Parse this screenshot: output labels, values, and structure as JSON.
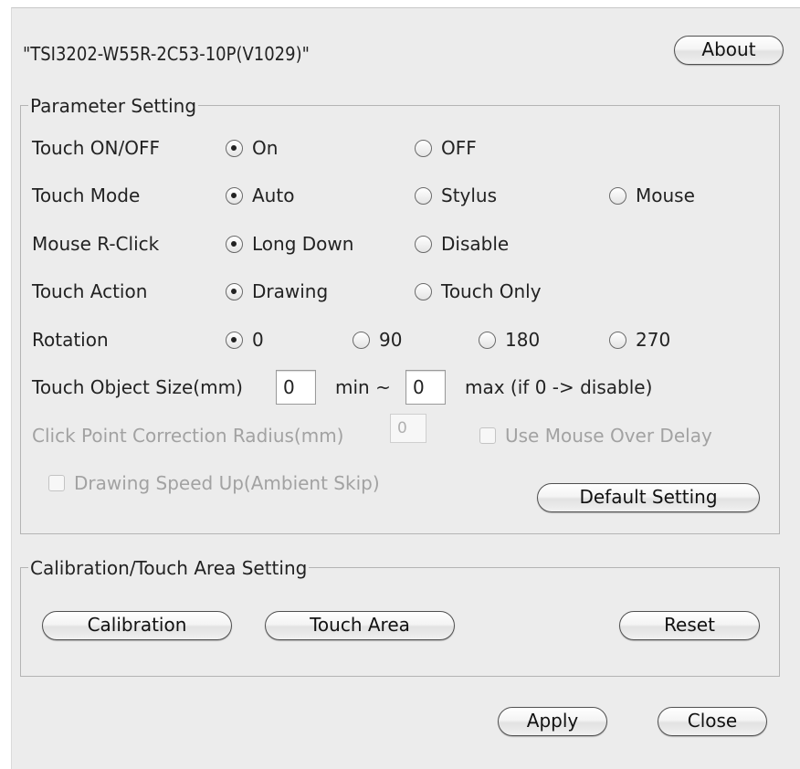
{
  "header": {
    "device_title": "\"TSI3202-W55R-2C53-10P(V1029)\"",
    "about_label": "About"
  },
  "parameter_setting": {
    "title": "Parameter Setting",
    "rows": {
      "touch_onoff": {
        "label": "Touch ON/OFF",
        "options": [
          "On",
          "OFF"
        ],
        "selected": "On"
      },
      "touch_mode": {
        "label": "Touch Mode",
        "options": [
          "Auto",
          "Stylus",
          "Mouse"
        ],
        "selected": "Auto"
      },
      "mouse_rclick": {
        "label": "Mouse R-Click",
        "options": [
          "Long Down",
          "Disable"
        ],
        "selected": "Long Down"
      },
      "touch_action": {
        "label": "Touch Action",
        "options": [
          "Drawing",
          "Touch Only"
        ],
        "selected": "Drawing"
      },
      "rotation": {
        "label": "Rotation",
        "options": [
          "0",
          "90",
          "180",
          "270"
        ],
        "selected": "0"
      }
    },
    "object_size": {
      "label": "Touch Object Size(mm)",
      "min_value": "0",
      "min_label": "min ~",
      "max_value": "0",
      "max_label": "max (if 0 -> disable)"
    },
    "correction": {
      "label": "Click Point Correction Radius(mm)",
      "value": "0",
      "enabled": false
    },
    "mouse_over_delay": {
      "label": "Use Mouse Over Delay",
      "checked": false,
      "enabled": false
    },
    "drawing_speed_up": {
      "label": "Drawing Speed Up(Ambient Skip)",
      "checked": false,
      "enabled": false
    },
    "default_label": "Default Setting"
  },
  "calibration_setting": {
    "title": "Calibration/Touch Area Setting",
    "calibration_label": "Calibration",
    "touch_area_label": "Touch Area",
    "reset_label": "Reset"
  },
  "footer": {
    "apply_label": "Apply",
    "close_label": "Close"
  }
}
